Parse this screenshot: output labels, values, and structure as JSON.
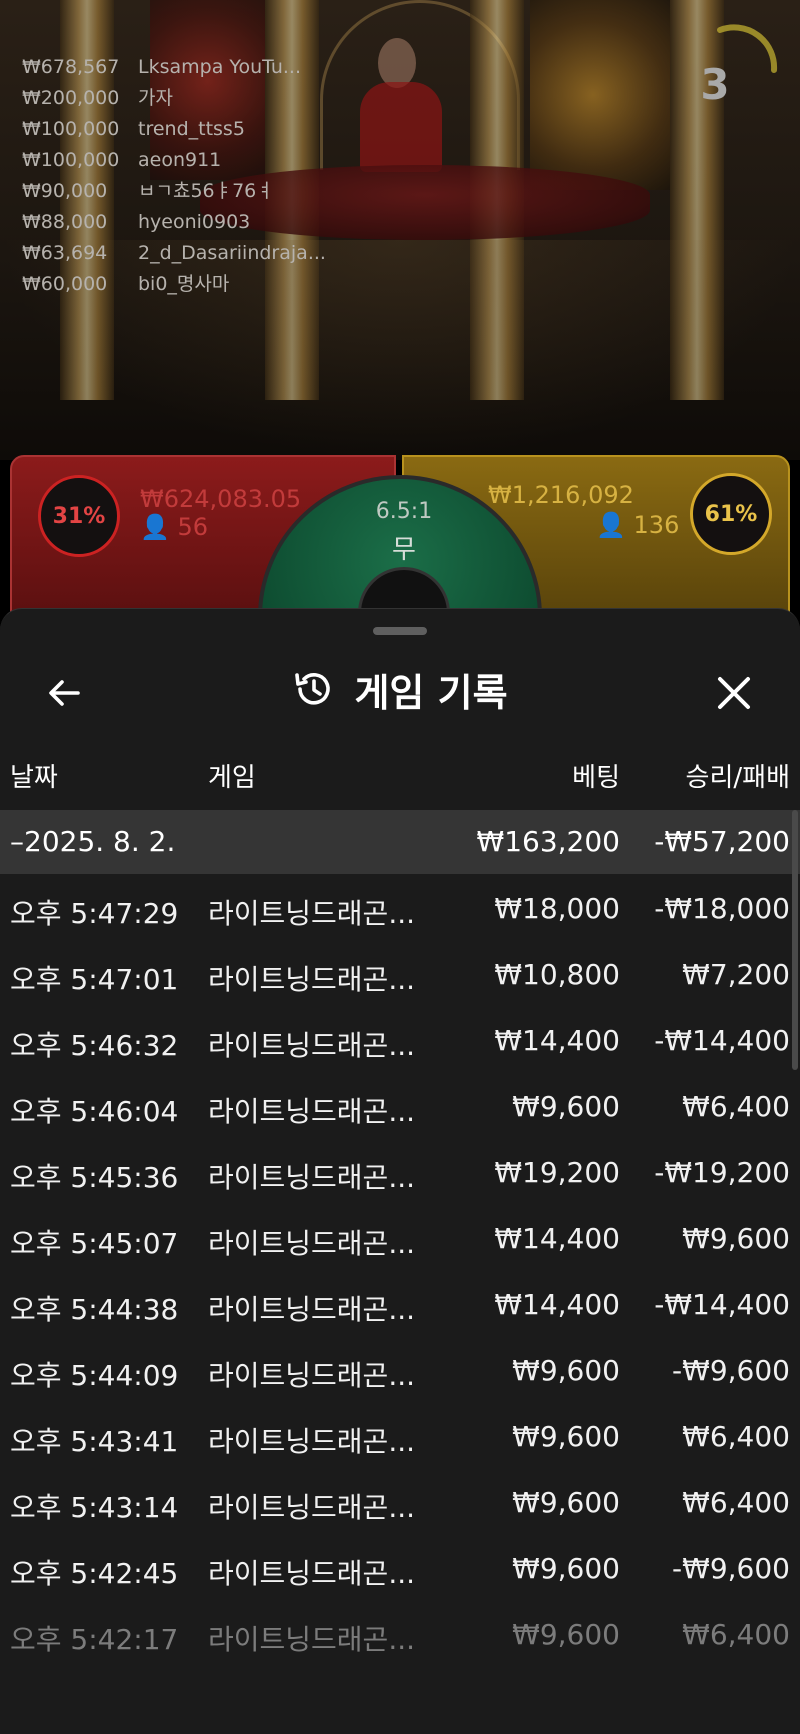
{
  "leaderboard": [
    {
      "amount": "₩678,567",
      "name": "Lksampa YouTu..."
    },
    {
      "amount": "₩200,000",
      "name": "가자"
    },
    {
      "amount": "₩100,000",
      "name": "trend_ttss5"
    },
    {
      "amount": "₩100,000",
      "name": "aeon911"
    },
    {
      "amount": "₩90,000",
      "name": "ㅂㄱ쵸56ㅑ76ㅕ"
    },
    {
      "amount": "₩88,000",
      "name": "hyeoni0903"
    },
    {
      "amount": "₩63,694",
      "name": "2_d_Dasariindraja..."
    },
    {
      "amount": "₩60,000",
      "name": "bi0_명사마"
    }
  ],
  "timer": {
    "value": "3"
  },
  "betting": {
    "dragon": {
      "percent": "31%",
      "amount": "₩624,083.05",
      "players": "56"
    },
    "tiger": {
      "percent": "61%",
      "amount": "₩1,216,092",
      "players": "136"
    },
    "tie": {
      "odds": "6.5:1",
      "label": "무"
    }
  },
  "sheet": {
    "title": "게임 기록",
    "columns": {
      "date": "날짜",
      "game": "게임",
      "bet": "베팅",
      "winloss": "승리/패배"
    },
    "day": {
      "date": "–2025. 8. 2.",
      "bet": "₩163,200",
      "winloss": "-₩57,200"
    },
    "rows": [
      {
        "time": "오후 5:47:29",
        "game": "라이트닝드래곤...",
        "bet": "₩18,000",
        "winloss": "-₩18,000"
      },
      {
        "time": "오후 5:47:01",
        "game": "라이트닝드래곤...",
        "bet": "₩10,800",
        "winloss": "₩7,200"
      },
      {
        "time": "오후 5:46:32",
        "game": "라이트닝드래곤...",
        "bet": "₩14,400",
        "winloss": "-₩14,400"
      },
      {
        "time": "오후 5:46:04",
        "game": "라이트닝드래곤...",
        "bet": "₩9,600",
        "winloss": "₩6,400"
      },
      {
        "time": "오후 5:45:36",
        "game": "라이트닝드래곤...",
        "bet": "₩19,200",
        "winloss": "-₩19,200"
      },
      {
        "time": "오후 5:45:07",
        "game": "라이트닝드래곤...",
        "bet": "₩14,400",
        "winloss": "₩9,600"
      },
      {
        "time": "오후 5:44:38",
        "game": "라이트닝드래곤...",
        "bet": "₩14,400",
        "winloss": "-₩14,400"
      },
      {
        "time": "오후 5:44:09",
        "game": "라이트닝드래곤...",
        "bet": "₩9,600",
        "winloss": "-₩9,600"
      },
      {
        "time": "오후 5:43:41",
        "game": "라이트닝드래곤...",
        "bet": "₩9,600",
        "winloss": "₩6,400"
      },
      {
        "time": "오후 5:43:14",
        "game": "라이트닝드래곤...",
        "bet": "₩9,600",
        "winloss": "₩6,400"
      },
      {
        "time": "오후 5:42:45",
        "game": "라이트닝드래곤...",
        "bet": "₩9,600",
        "winloss": "-₩9,600"
      },
      {
        "time": "오후 5:42:17",
        "game": "라이트닝드래곤...",
        "bet": "₩9,600",
        "winloss": "₩6,400"
      }
    ]
  }
}
